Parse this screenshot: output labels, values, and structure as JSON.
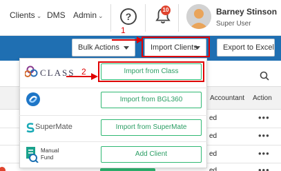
{
  "nav": {
    "clients": "Clients",
    "dms": "DMS",
    "admin": "Admin",
    "help_glyph": "?",
    "notification_count": "10",
    "user_name": "Barney Stinson",
    "user_role": "Super User"
  },
  "toolbar": {
    "bulk_actions": "Bulk Actions",
    "import_clients": "Import Clients",
    "export_excel": "Export to Excel"
  },
  "annotations": {
    "step1": "1",
    "step2": "2"
  },
  "table": {
    "headers": {
      "accountant": "Accountant",
      "action": "Action"
    },
    "rows": [
      {
        "text": "ed",
        "action": "•••"
      },
      {
        "text": "ed",
        "action": "•••"
      },
      {
        "text": "ed",
        "action": "•••"
      },
      {
        "text": "ed",
        "action": "•••"
      }
    ]
  },
  "import_menu": {
    "items": [
      {
        "logo": "CLASS",
        "button": "Import from Class"
      },
      {
        "logo": "",
        "button": "Import from BGL360"
      },
      {
        "logo": "SuperMate",
        "button": "Import from SuperMate"
      },
      {
        "logo_line1": "Manual",
        "logo_line2": "Fund",
        "button": "Add Client"
      }
    ]
  },
  "colors": {
    "blue_bar": "#1f6fb2",
    "green": "#2eb872",
    "annotation_red": "#e00000",
    "badge_red": "#e0442e"
  },
  "icons": [
    "help-icon",
    "bell-icon",
    "avatar",
    "search-icon",
    "class-logo",
    "bgl360-logo",
    "supermate-logo",
    "manual-fund-logo",
    "chevron-down-icon",
    "caret-down-icon",
    "arrow-icon"
  ]
}
